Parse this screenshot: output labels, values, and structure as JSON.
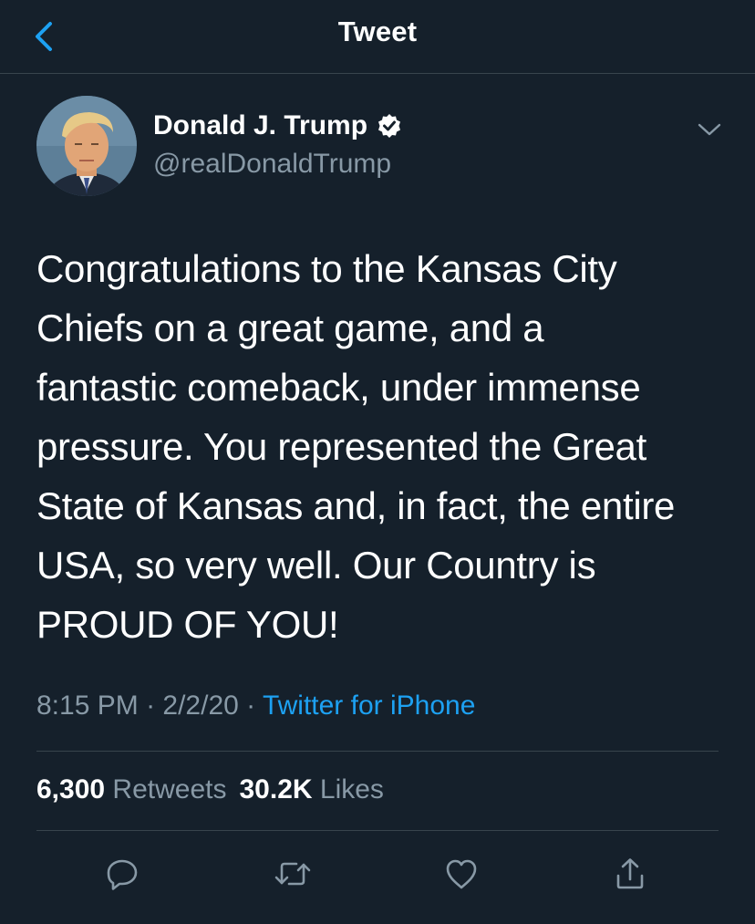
{
  "header": {
    "title": "Tweet"
  },
  "author": {
    "name": "Donald J. Trump",
    "handle": "@realDonaldTrump",
    "verified": true
  },
  "tweet": {
    "text": "Congratulations to the Kansas City\nChiefs on a great game, and a\nfantastic comeback, under immense\npressure. You represented the Great\nState of Kansas and, in fact, the entire\nUSA, so very well. Our Country is\nPROUD OF YOU!",
    "time": "8:15 PM",
    "date": "2/2/20",
    "separator": " · ",
    "source": "Twitter for iPhone"
  },
  "stats": {
    "retweets_count": "6,300",
    "retweets_label": "Retweets",
    "likes_count": "30.2K",
    "likes_label": "Likes"
  },
  "actions": [
    "reply-icon",
    "retweet-icon",
    "like-icon",
    "share-icon"
  ],
  "colors": {
    "background": "#15202b",
    "divider": "#38444d",
    "secondary_text": "#8899a6",
    "accent": "#1da1f2"
  }
}
